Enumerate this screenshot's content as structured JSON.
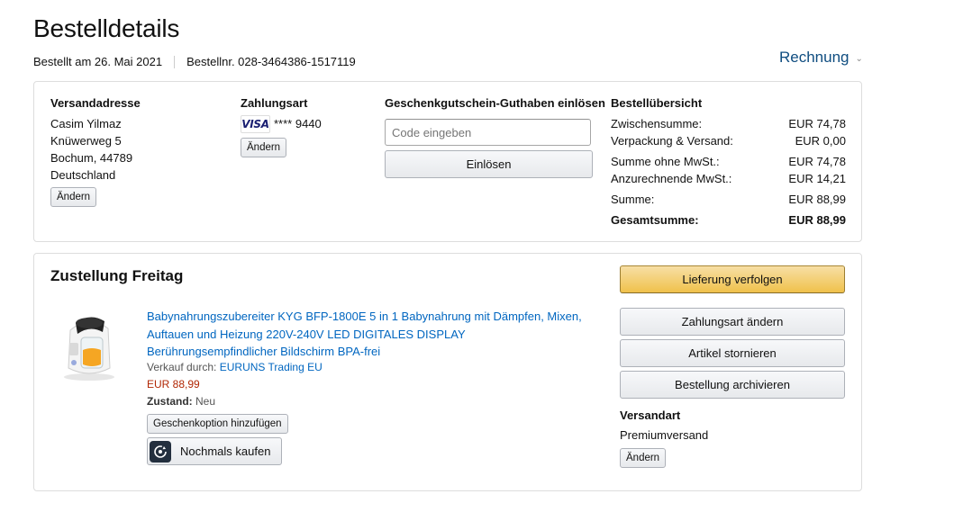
{
  "header": {
    "title": "Bestelldetails",
    "ordered_on": "Bestellt am 26. Mai 2021",
    "order_number": "Bestellnr. 028-3464386-1517119",
    "invoice_label": "Rechnung"
  },
  "summary": {
    "shipping_address": {
      "heading": "Versandadresse",
      "lines": [
        "Casim Yilmaz",
        "Knüwerweg 5",
        "Bochum, 44789",
        "Deutschland"
      ],
      "change_label": "Ändern"
    },
    "payment": {
      "heading": "Zahlungsart",
      "card_brand": "VISA",
      "card_number": "**** 9440",
      "change_label": "Ändern"
    },
    "gift_card": {
      "heading": "Geschenkgutschein-Guthaben einlösen",
      "placeholder": "Code eingeben",
      "redeem_label": "Einlösen"
    },
    "order_summary": {
      "heading": "Bestellübersicht",
      "rows": [
        {
          "label": "Zwischensumme:",
          "value": "EUR 74,78"
        },
        {
          "label": "Verpackung & Versand:",
          "value": "EUR 0,00"
        },
        {
          "label": "Summe ohne MwSt.:",
          "value": "EUR 74,78"
        },
        {
          "label": "Anzurechnende MwSt.:",
          "value": "EUR 14,21"
        },
        {
          "label": "Summe:",
          "value": "EUR 88,99"
        },
        {
          "label": "Gesamtsumme:",
          "value": "EUR 88,99"
        }
      ]
    }
  },
  "delivery": {
    "title": "Zustellung Freitag",
    "product": {
      "title": "Babynahrungszubereiter KYG BFP-1800E 5 in 1 Babynahrung mit Dämpfen, Mixen, Auftauen und Heizung 220V-240V LED DIGITALES DISPLAY Berührungsempfindlicher Bildschirm BPA-frei",
      "sold_by_label": "Verkauf durch:",
      "seller": "EURUNS Trading EU",
      "price": "EUR 88,99",
      "condition_label": "Zustand:",
      "condition": "Neu",
      "gift_option_label": "Geschenkoption hinzufügen",
      "buy_again_label": "Nochmals kaufen"
    },
    "actions": {
      "track": "Lieferung verfolgen",
      "change_payment": "Zahlungsart ändern",
      "cancel": "Artikel stornieren",
      "archive": "Bestellung archivieren"
    },
    "shipping_method": {
      "heading": "Versandart",
      "value": "Premiumversand",
      "change_label": "Ändern"
    }
  },
  "colors": {
    "link": "#0066c0",
    "price": "#b12704",
    "primary_button": "#f0c14b"
  }
}
